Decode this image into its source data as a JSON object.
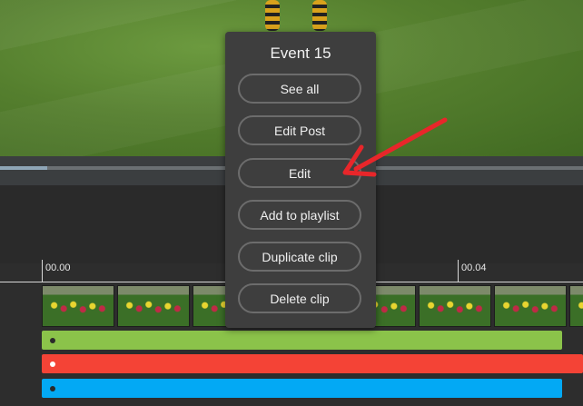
{
  "menu": {
    "title": "Event 15",
    "items": [
      {
        "label": "See all"
      },
      {
        "label": "Edit Post"
      },
      {
        "label": "Edit"
      },
      {
        "label": "Add to playlist"
      },
      {
        "label": "Duplicate clip"
      },
      {
        "label": "Delete clip"
      }
    ]
  },
  "timeline": {
    "ticks": [
      "00.00",
      "00.04"
    ]
  },
  "colors": {
    "track_green": "#8bc34a",
    "track_red": "#f44336",
    "track_blue": "#03a9f4",
    "annotation_arrow": "#e8262a"
  },
  "annotation": {
    "icon": "red-arrow-icon",
    "points_to": "Edit"
  }
}
